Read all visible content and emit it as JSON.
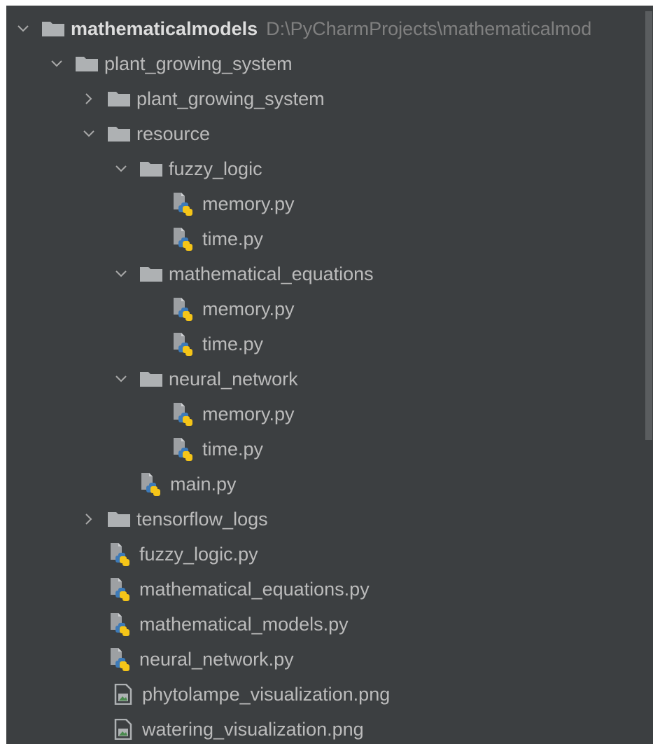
{
  "tree": {
    "root": {
      "name": "mathematicalmodels",
      "path": "D:\\PyCharmProjects\\mathematicalmod",
      "expanded": true
    },
    "items": [
      {
        "name": "plant_growing_system",
        "type": "folder",
        "expanded": true
      },
      {
        "name": "plant_growing_system",
        "type": "folder",
        "expanded": false
      },
      {
        "name": "resource",
        "type": "folder",
        "expanded": true
      },
      {
        "name": "fuzzy_logic",
        "type": "folder",
        "expanded": true
      },
      {
        "name": "memory.py",
        "type": "python-file"
      },
      {
        "name": "time.py",
        "type": "python-file"
      },
      {
        "name": "mathematical_equations",
        "type": "folder",
        "expanded": true
      },
      {
        "name": "memory.py",
        "type": "python-file"
      },
      {
        "name": "time.py",
        "type": "python-file"
      },
      {
        "name": "neural_network",
        "type": "folder",
        "expanded": true
      },
      {
        "name": "memory.py",
        "type": "python-file"
      },
      {
        "name": "time.py",
        "type": "python-file"
      },
      {
        "name": "main.py",
        "type": "python-file"
      },
      {
        "name": "tensorflow_logs",
        "type": "folder",
        "expanded": false
      },
      {
        "name": "fuzzy_logic.py",
        "type": "python-file"
      },
      {
        "name": "mathematical_equations.py",
        "type": "python-file"
      },
      {
        "name": "mathematical_models.py",
        "type": "python-file"
      },
      {
        "name": "neural_network.py",
        "type": "python-file"
      },
      {
        "name": "phytolampe_visualization.png",
        "type": "image-file"
      },
      {
        "name": "watering_visualization.png",
        "type": "image-file"
      }
    ]
  },
  "colors": {
    "background": "#3c3f41",
    "text": "#bbbbbb",
    "path_text": "#808080",
    "folder": "#aeb1b3",
    "python_blue": "#3d7ab8",
    "python_yellow": "#f5c518"
  }
}
